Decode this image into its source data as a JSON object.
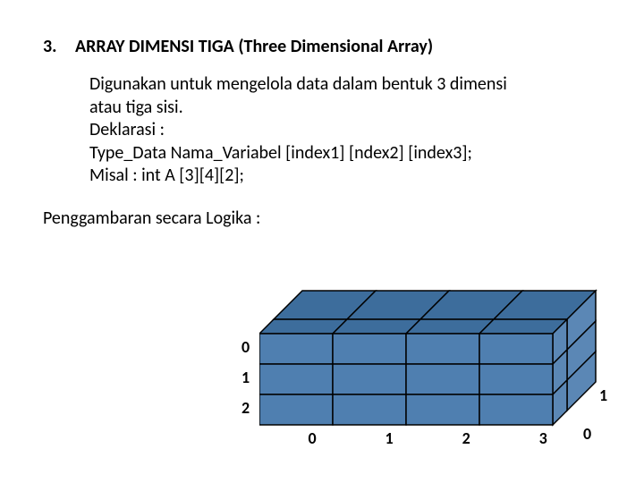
{
  "heading": {
    "number": "3.",
    "title": "ARRAY DIMENSI TIGA (Three Dimensional Array)"
  },
  "body": {
    "line1": "Digunakan untuk mengelola data dalam bentuk 3 dimensi",
    "line2": "atau tiga sisi.",
    "line3": "Deklarasi :",
    "line4": "Type_Data Nama_Variabel [index1] [ndex2] [index3];",
    "line5": "Misal : int A [3][4][2];"
  },
  "logika_label": "Penggambaran secara Logika :",
  "diagram": {
    "row_labels": [
      "0",
      "1",
      "2"
    ],
    "col_labels": [
      "0",
      "1",
      "2",
      "3"
    ],
    "depth_labels": [
      "1",
      "0"
    ]
  }
}
